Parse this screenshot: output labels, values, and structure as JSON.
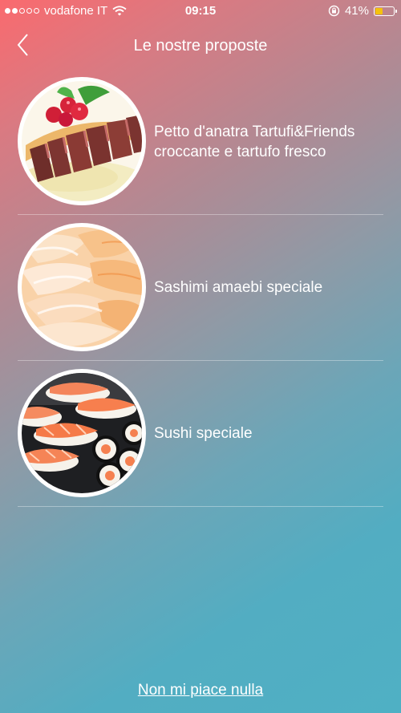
{
  "status_bar": {
    "carrier": "vodafone IT",
    "time": "09:15",
    "battery": "41%",
    "battery_level": 0.41
  },
  "header": {
    "title": "Le nostre proposte"
  },
  "items": [
    {
      "label": "Petto d'anatra Tartufi&Friends croccante e tartufo fresco",
      "image": "duck-breast-photo"
    },
    {
      "label": "Sashimi amaebi speciale",
      "image": "amaebi-sashimi-photo"
    },
    {
      "label": "Sushi speciale",
      "image": "sushi-photo"
    }
  ],
  "footer": {
    "link": "Non mi piace nulla"
  },
  "colors": {
    "gradient_start": "#fa6a6e",
    "gradient_end": "#4fb0c4",
    "battery_fill": "#f4c20d"
  }
}
